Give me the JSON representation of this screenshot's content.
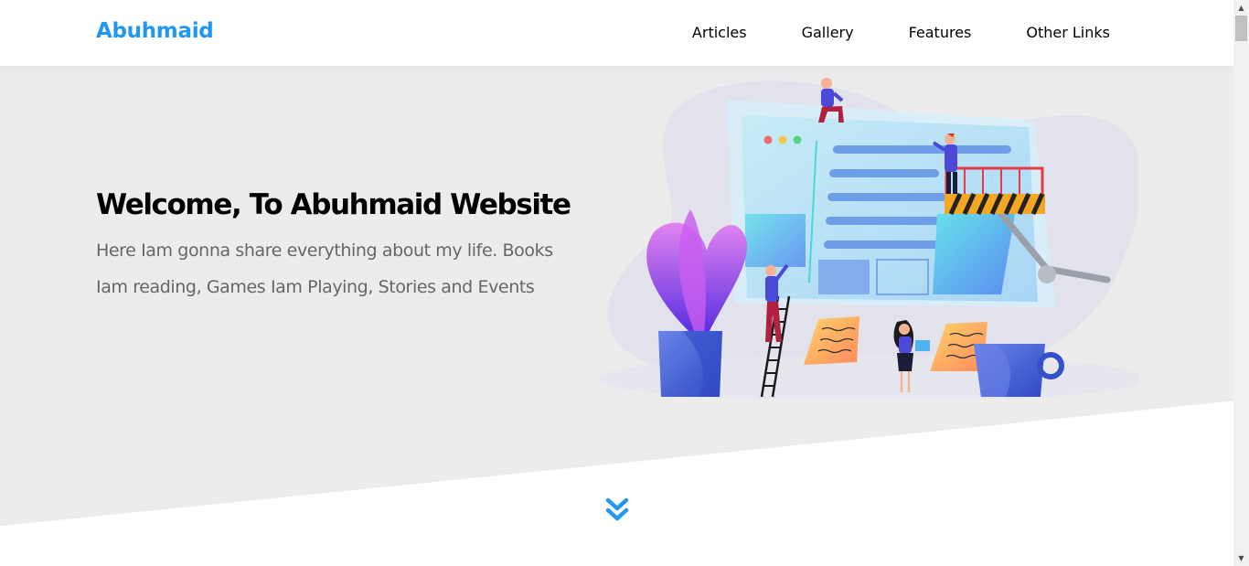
{
  "header": {
    "logo": "Abuhmaid",
    "nav": [
      {
        "label": "Articles"
      },
      {
        "label": "Gallery"
      },
      {
        "label": "Features"
      },
      {
        "label": "Other Links"
      }
    ]
  },
  "landing": {
    "title": "Welcome, To Abuhmaid Website",
    "description": "Here Iam gonna share everything about my life. Books Iam reading, Games Iam Playing, Stories and Events",
    "illustration_icon": "website-building-illustration",
    "go_down_icon": "double-chevron-down-icon"
  },
  "colors": {
    "brand": "#2196f3",
    "hero_background": "#ececec",
    "heading": "#000000",
    "body_text": "#666666"
  }
}
